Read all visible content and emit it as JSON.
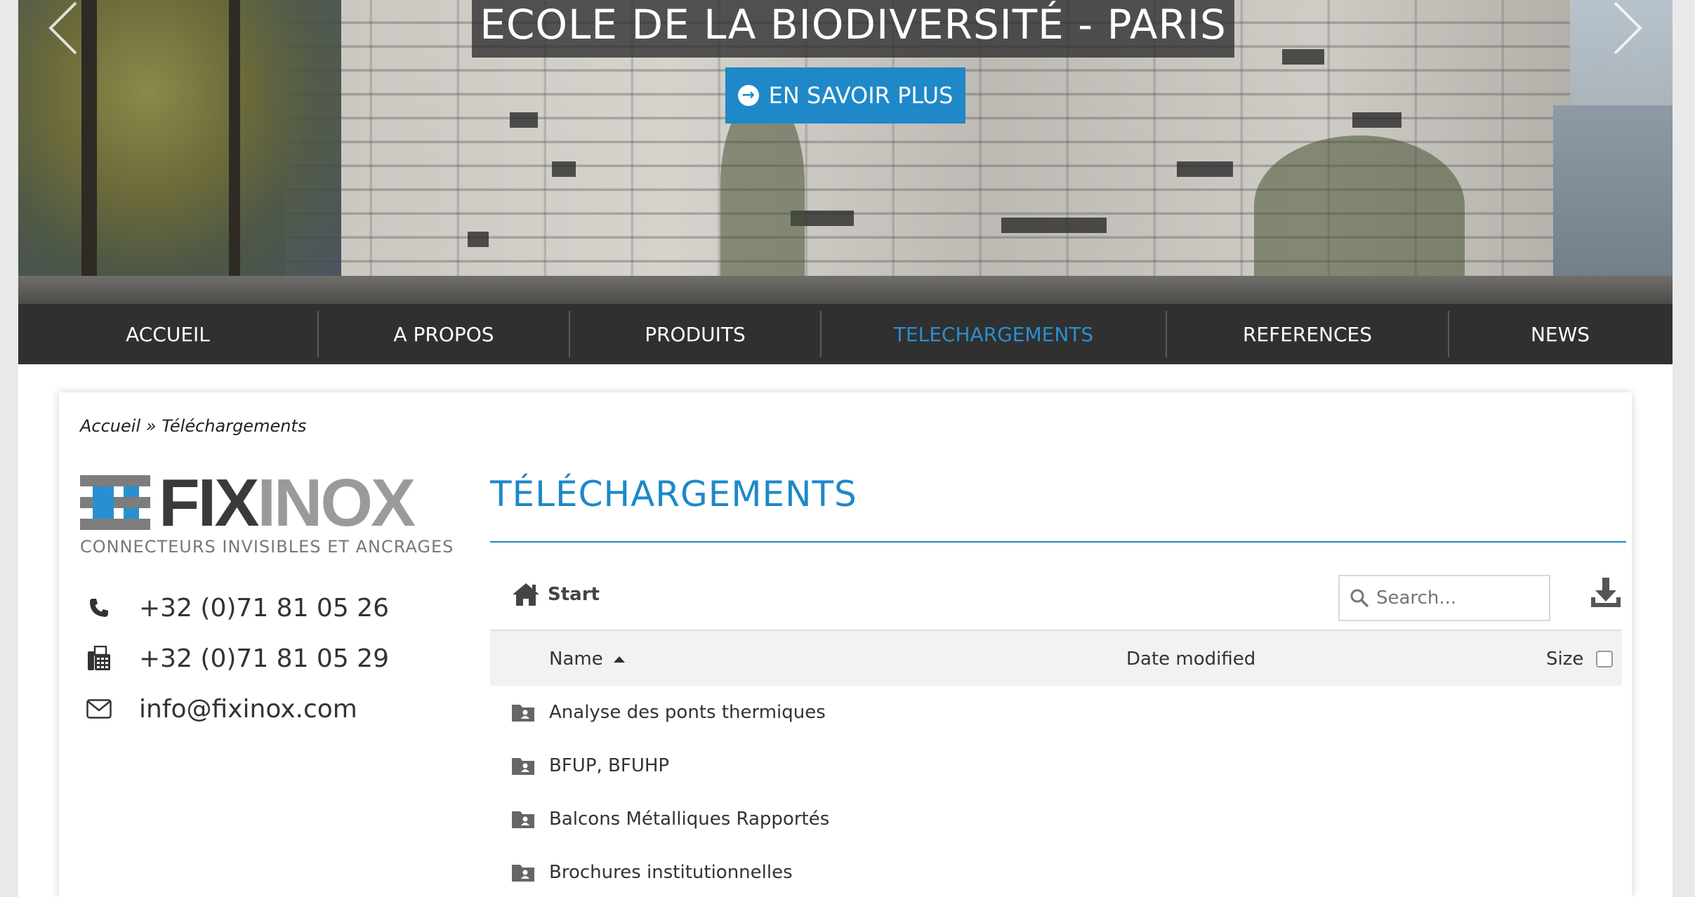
{
  "hero": {
    "title": "ECOLE DE LA BIODIVERSITÉ - PARIS",
    "cta_label": "EN SAVOIR PLUS"
  },
  "nav": {
    "items": [
      {
        "label": "ACCUEIL",
        "active": false
      },
      {
        "label": "A PROPOS",
        "active": false
      },
      {
        "label": "PRODUITS",
        "active": false
      },
      {
        "label": "TELECHARGEMENTS",
        "active": true
      },
      {
        "label": "REFERENCES",
        "active": false
      },
      {
        "label": "NEWS",
        "active": false
      }
    ]
  },
  "breadcrumb": "Accueil » Téléchargements",
  "brand": {
    "name_part1": "FIX",
    "name_part2": "INOX",
    "tagline": "CONNECTEURS INVISIBLES ET ANCRAGES"
  },
  "contact": {
    "phone": "+32 (0)71 81 05 26",
    "fax": "+32 (0)71 81 05 29",
    "email": "info@fixinox.com"
  },
  "page_title": "TÉLÉCHARGEMENTS",
  "file_manager": {
    "start_label": "Start",
    "search_placeholder": "Search...",
    "columns": {
      "name": "Name",
      "date": "Date modified",
      "size": "Size"
    },
    "folders": [
      "Analyse des ponts thermiques",
      "BFUP, BFUHP",
      "Balcons Métalliques Rapportés",
      "Brochures institutionnelles"
    ]
  },
  "colors": {
    "accent": "#1e88c8",
    "nav_bg": "#303030",
    "nav_active": "#2a8fd0"
  }
}
